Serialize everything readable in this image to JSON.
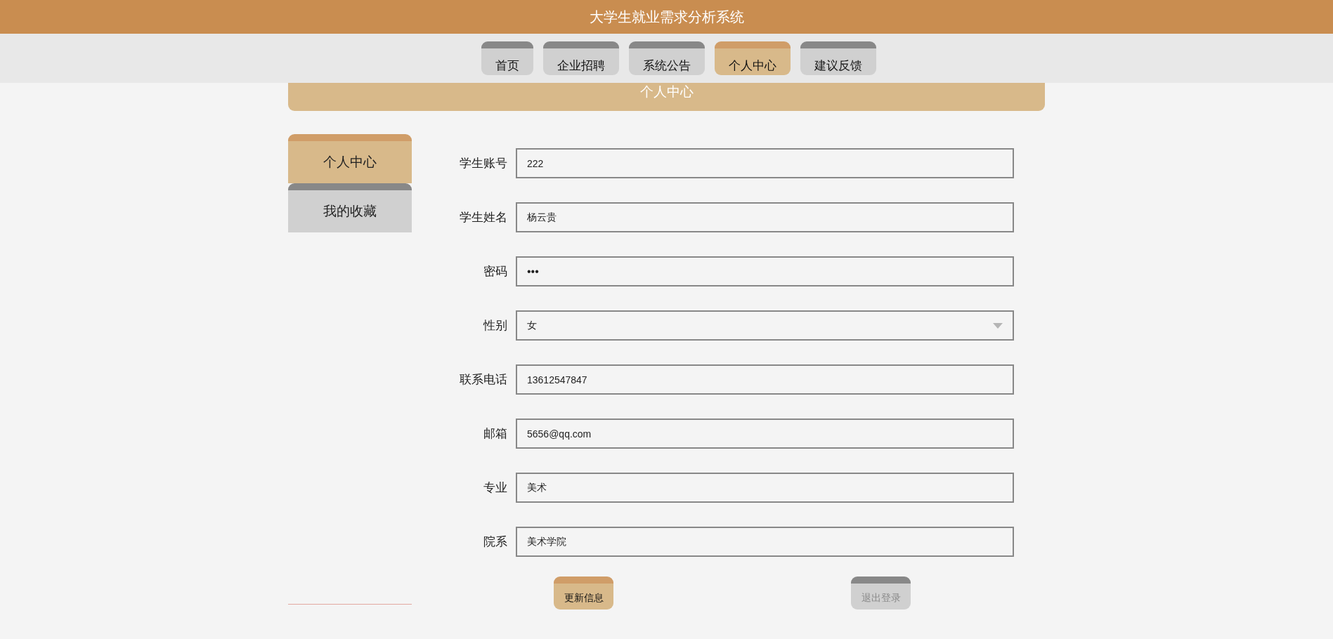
{
  "header": {
    "title": "大学生就业需求分析系统"
  },
  "nav": [
    {
      "label": "首页",
      "selected": false
    },
    {
      "label": "企业招聘",
      "selected": false
    },
    {
      "label": "系统公告",
      "selected": false
    },
    {
      "label": "个人中心",
      "selected": true
    },
    {
      "label": "建议反馈",
      "selected": false
    }
  ],
  "panel": {
    "title": "个人中心"
  },
  "sidebar": {
    "items": [
      {
        "label": "个人中心",
        "selected": true
      },
      {
        "label": "我的收藏",
        "selected": false
      }
    ]
  },
  "form": {
    "fields": [
      {
        "kind": "text",
        "label": "学生账号",
        "value": "222"
      },
      {
        "kind": "text",
        "label": "学生姓名",
        "value": "杨云贵"
      },
      {
        "kind": "password",
        "label": "密码",
        "value": "•••"
      },
      {
        "kind": "select",
        "label": "性别",
        "value": "女"
      },
      {
        "kind": "text",
        "label": "联系电话",
        "value": "13612547847"
      },
      {
        "kind": "text",
        "label": "邮箱",
        "value": "5656@qq.com"
      },
      {
        "kind": "text",
        "label": "专业",
        "value": "美术"
      },
      {
        "kind": "text",
        "label": "院系",
        "value": "美术学院"
      }
    ],
    "buttons": [
      {
        "label": "更新信息",
        "disabled": false
      },
      {
        "label": "退出登录",
        "disabled": true
      }
    ]
  }
}
